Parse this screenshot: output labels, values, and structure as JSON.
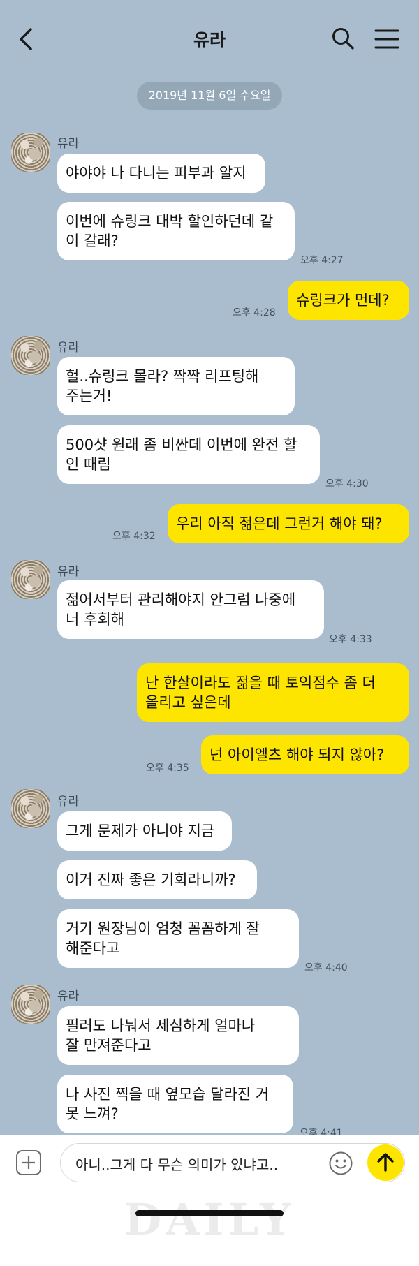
{
  "header": {
    "title": "유라",
    "back_icon": "chevron-left-icon",
    "search_icon": "search-icon",
    "menu_icon": "hamburger-menu-icon"
  },
  "date_divider": "2019년 11월 6일 수요일",
  "groups": [
    {
      "sender": "유라",
      "messages": [
        "야야야 나 다니는 피부과 알지",
        "이번에 슈링크 대박 할인하던데 같\n이 갈래?"
      ],
      "time": "오후 4:27"
    },
    {
      "messages": [
        "슈링크가 먼데?"
      ],
      "time": "오후 4:28"
    },
    {
      "sender": "유라",
      "messages": [
        "헐..슈링크 몰라? 짝짝 리프팅해\n주는거!",
        "500샷 원래 좀 비싼데 이번에 완전 할\n인 때림"
      ],
      "time": "오후 4:30"
    },
    {
      "messages": [
        "우리 아직 젊은데 그런거 해야 돼?"
      ],
      "time": "오후 4:32"
    },
    {
      "sender": "유라",
      "messages": [
        "젊어서부터 관리해야지 안그럼 나중에\n너 후회해"
      ],
      "time": "오후 4:33"
    },
    {
      "messages": [
        "난 한살이라도 젊을 때 토익점수 좀 더\n올리고 싶은데",
        "넌 아이엘츠 해야 되지 않아?"
      ],
      "time": "오후 4:35"
    },
    {
      "sender": "유라",
      "messages": [
        "그게 문제가 아니야 지금",
        "이거 진짜 좋은 기회라니까?",
        "거기 원장님이 엄청 꼼꼼하게 잘\n해준다고"
      ],
      "time": "오후 4:40"
    },
    {
      "sender": "유라",
      "messages": [
        "필러도 나눠서 세심하게 얼마나\n잘 만져준다고",
        "나 사진 찍을 때 옆모습 달라진 거\n못 느껴?"
      ],
      "time": "오후 4:41"
    }
  ],
  "composer": {
    "input_value": "아니..그게 다 무슨 의미가 있냐고..",
    "add_icon": "plus-icon",
    "emoji_icon": "emoji-icon",
    "send_icon": "arrow-up-icon"
  },
  "watermark": "DAILY",
  "colors": {
    "background": "#a9bdce",
    "incoming_bubble": "#ffffff",
    "outgoing_bubble": "#fee500",
    "date_pill": "#94a7b7"
  }
}
